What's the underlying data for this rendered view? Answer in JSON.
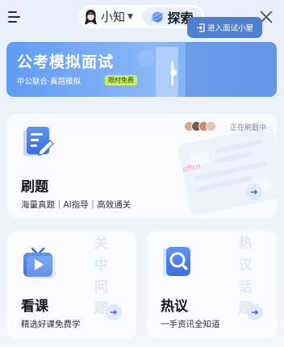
{
  "header": {
    "menu_icon": "menu-icon",
    "mode_xiaozhi": "小知",
    "mode_explore": "探索",
    "close_icon": "close-icon"
  },
  "banner": {
    "title": "公考模拟面试",
    "subtitle": "中公联合·真题模拟",
    "tag": "限时免费",
    "button": "进入面试小屋"
  },
  "cards": {
    "main": {
      "title": "刷题",
      "subtitle": "海量真题｜AI指导｜高效通关",
      "status": "正在刷题中",
      "icon": "document-pencil-icon"
    },
    "left": {
      "title": "看课",
      "subtitle": "精选好课免费学",
      "icon": "video-play-icon"
    },
    "right": {
      "title": "热议",
      "subtitle": "一手资讯全知道",
      "icon": "magnifier-icon"
    }
  },
  "colors": {
    "accent": "#4f86ec",
    "banner": "#6ea1ee",
    "tag": "#c8f25b"
  }
}
